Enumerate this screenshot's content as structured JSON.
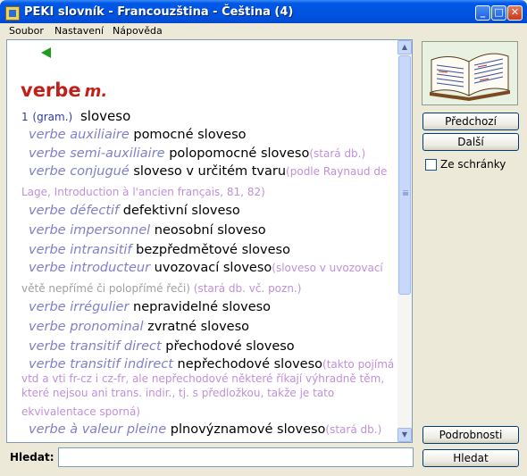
{
  "window": {
    "title": "PEKI slovník - Francouzština - Čeština  (4)",
    "minimize_glyph": "_",
    "maximize_glyph": "□",
    "close_glyph": "✕"
  },
  "menu": [
    "Soubor",
    "Nastavení",
    "Nápověda"
  ],
  "entry": {
    "headword": "verbe",
    "gender": "m.",
    "sense_number": "1",
    "sense_label": "(gram.)",
    "sense_translation": "sloveso",
    "rows": [
      {
        "fr": "verbe auxiliaire",
        "cs": " pomocné sloveso",
        "note": ""
      },
      {
        "fr": "verbe semi-auxiliaire",
        "cs": " polopomocné sloveso",
        "note": "(stará db.)"
      },
      {
        "fr": "verbe conjugué",
        "cs": " sloveso v určitém tvaru",
        "note": "(podle Raynaud de"
      },
      {
        "fr": "verbe défectif",
        "cs": " defektivní sloveso",
        "note": ""
      },
      {
        "fr": "verbe impersonnel",
        "cs": " neosobní sloveso",
        "note": ""
      },
      {
        "fr": "verbe intransitif",
        "cs": " bezpředmětové sloveso",
        "note": ""
      },
      {
        "fr": "verbe introducteur",
        "cs": " uvozovací sloveso",
        "note": "(sloveso v uvozovací"
      },
      {
        "fr": "verbe irrégulier",
        "cs": " nepravidelné sloveso",
        "note": ""
      },
      {
        "fr": "verbe pronominal",
        "cs": " zvratné sloveso",
        "note": ""
      },
      {
        "fr": "verbe transitif direct",
        "cs": " přechodové sloveso",
        "note": ""
      },
      {
        "fr": "verbe transitif indirect",
        "cs": " nepřechodové sloveso",
        "note": "(takto pojímá"
      },
      {
        "fr": "verbe à valeur pleine",
        "cs": " plnovýznamové sloveso",
        "note": "(stará db.)"
      }
    ],
    "continuations": {
      "conjugue": "Lage, Introduction à l'ancien français, 81, 82)",
      "introducteur_gray": "větě nepřímé či polopřímé řeči)",
      "introducteur_note": " (stará db. vč. pozn.)",
      "indirect_1": "vtd a vti fr-cz i cz-fr, ale nepřechodové některé říkají výhradně těm,",
      "indirect_2": "které nejsou ani trans. indir., tj. s předložkou, takže je tato",
      "indirect_3": "ekvivalentace sporná)"
    }
  },
  "sidebar": {
    "prev": "Předchozí",
    "next": "Další",
    "clipboard_label": "Ze schránky",
    "clipboard_checked": false,
    "details": "Podrobnosti",
    "search_button": "Hledat"
  },
  "search": {
    "label": "Hledat:",
    "value": ""
  },
  "scrollbar": {
    "position": 0
  },
  "colors": {
    "headword": "#C0201A",
    "french": "#8080C8",
    "note": "#C090D8",
    "sense": "#2E3C9E"
  }
}
